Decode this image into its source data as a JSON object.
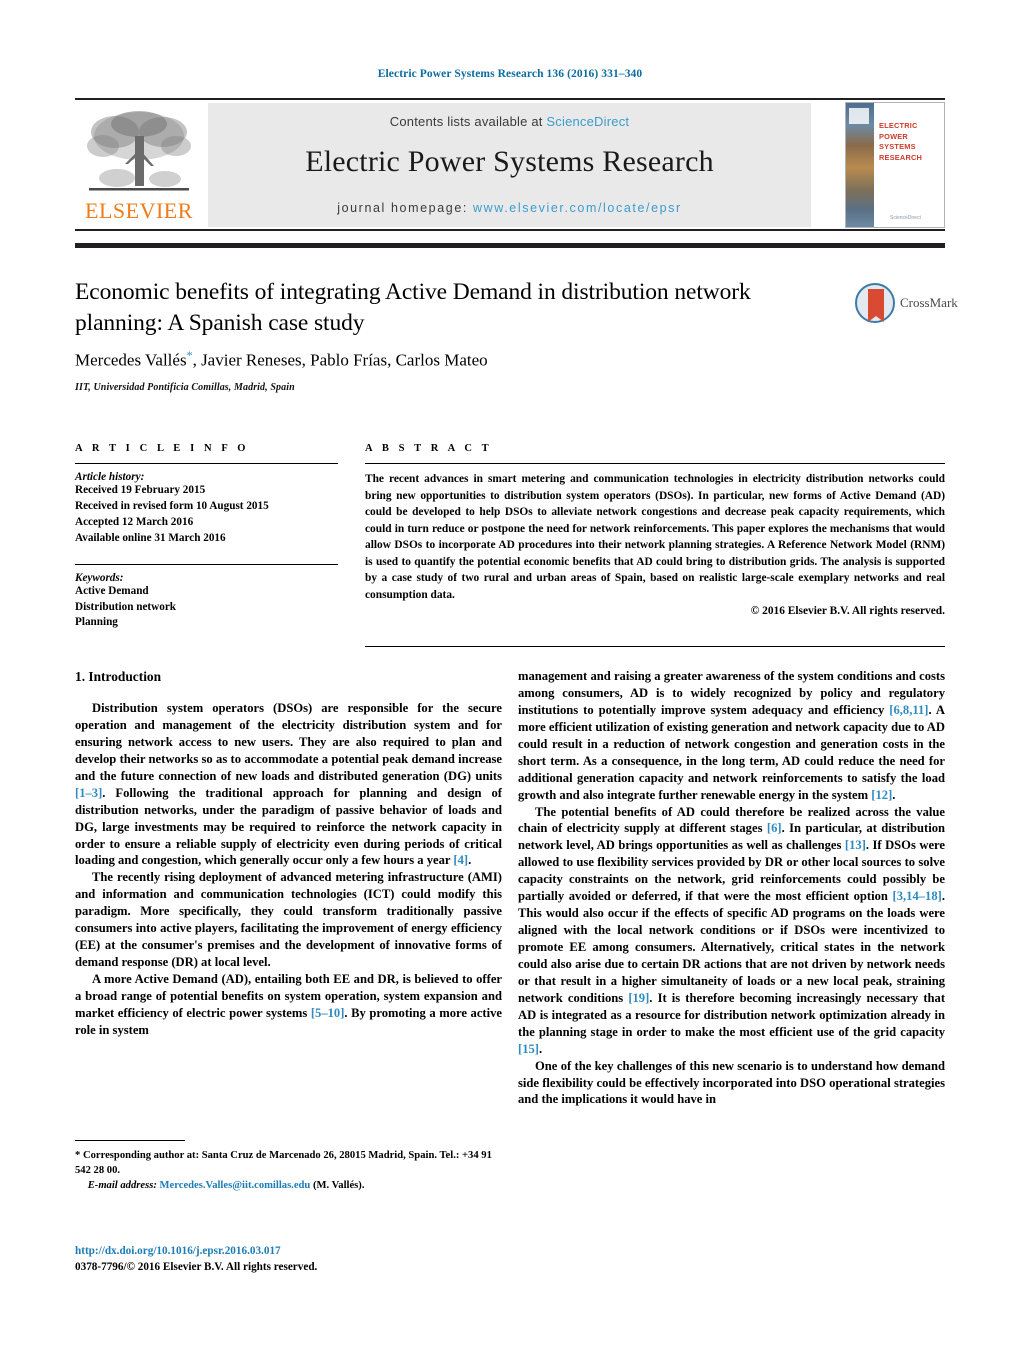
{
  "running_head": "Electric Power Systems Research 136 (2016) 331–340",
  "masthead": {
    "publisher_name": "ELSEVIER",
    "contents_prefix": "Contents lists available at ",
    "sciencedirect": "ScienceDirect",
    "journal_title": "Electric Power Systems Research",
    "homepage_prefix": "journal homepage: ",
    "homepage_url": "www.elsevier.com/locate/epsr",
    "cover": {
      "title_line1": "ELECTRIC POWER",
      "title_line2": "SYSTEMS RESEARCH",
      "footer": "ScienceDirect"
    }
  },
  "article": {
    "title": "Economic benefits of integrating Active Demand in distribution network planning: A Spanish case study",
    "authors_part1": "Mercedes Vallés",
    "authors_star": "*",
    "authors_part2": ", Javier Reneses, Pablo Frías, Carlos Mateo",
    "affiliation": "IIT, Universidad Pontificia Comillas, Madrid, Spain",
    "crossmark_label": "CrossMark"
  },
  "info": {
    "heading": "A R T I C L E   I N F O",
    "history_label": "Article history:",
    "history": [
      "Received 19 February 2015",
      "Received in revised form 10 August 2015",
      "Accepted 12 March 2016",
      "Available online 31 March 2016"
    ],
    "keywords_label": "Keywords:",
    "keywords": [
      "Active Demand",
      "Distribution network",
      "Planning"
    ]
  },
  "abstract": {
    "heading": "A B S T R A C T",
    "text": "The recent advances in smart metering and communication technologies in electricity distribution networks could bring new opportunities to distribution system operators (DSOs). In particular, new forms of Active Demand (AD) could be developed to help DSOs to alleviate network congestions and decrease peak capacity requirements, which could in turn reduce or postpone the need for network reinforcements. This paper explores the mechanisms that would allow DSOs to incorporate AD procedures into their network planning strategies. A Reference Network Model (RNM) is used to quantify the potential economic benefits that AD could bring to distribution grids. The analysis is supported by a case study of two rural and urban areas of Spain, based on realistic large-scale exemplary networks and real consumption data.",
    "copyright": "© 2016 Elsevier B.V. All rights reserved."
  },
  "body": {
    "section_heading": "1.  Introduction",
    "left_paragraphs": [
      {
        "segments": [
          {
            "t": "Distribution system operators (DSOs) are responsible for the secure operation and management of the electricity distribution system and for ensuring network access to new users. They are also required to plan and develop their networks so as to accommodate a potential peak demand increase and the future connection of new loads and distributed generation (DG) units "
          },
          {
            "t": "[1–3]",
            "ref": true
          },
          {
            "t": ". Following the traditional approach for planning and design of distribution networks, under the paradigm of passive behavior of loads and DG, large investments may be required to reinforce the network capacity in order to ensure a reliable supply of electricity even during periods of critical loading and congestion, which generally occur only a few hours a year "
          },
          {
            "t": "[4]",
            "ref": true
          },
          {
            "t": "."
          }
        ]
      },
      {
        "segments": [
          {
            "t": "The recently rising deployment of advanced metering infrastructure (AMI) and information and communication technologies (ICT) could modify this paradigm. More specifically, they could transform traditionally passive consumers into active players, facilitating the improvement of energy efficiency (EE) at the consumer's premises and the development of innovative forms of demand response (DR) at local level."
          }
        ]
      },
      {
        "segments": [
          {
            "t": "A more Active Demand (AD), entailing both EE and DR, is believed to offer a broad range of potential benefits on system operation, system expansion and market efficiency of electric power systems "
          },
          {
            "t": "[5–10]",
            "ref": true
          },
          {
            "t": ". By promoting a more active role in system"
          }
        ]
      }
    ],
    "right_paragraphs": [
      {
        "no_indent": true,
        "segments": [
          {
            "t": "management and raising a greater awareness of the system conditions and costs among consumers, AD is to widely recognized by policy and regulatory institutions to potentially improve system adequacy and efficiency "
          },
          {
            "t": "[6,8,11]",
            "ref": true
          },
          {
            "t": ". A more efficient utilization of existing generation and network capacity due to AD could result in a reduction of network congestion and generation costs in the short term. As a consequence, in the long term, AD could reduce the need for additional generation capacity and network reinforcements to satisfy the load growth and also integrate further renewable energy in the system "
          },
          {
            "t": "[12]",
            "ref": true
          },
          {
            "t": "."
          }
        ]
      },
      {
        "segments": [
          {
            "t": "The potential benefits of AD could therefore be realized across the value chain of electricity supply at different stages "
          },
          {
            "t": "[6]",
            "ref": true
          },
          {
            "t": ". In particular, at distribution network level, AD brings opportunities as well as challenges "
          },
          {
            "t": "[13]",
            "ref": true
          },
          {
            "t": ". If DSOs were allowed to use flexibility services provided by DR or other local sources to solve capacity constraints on the network, grid reinforcements could possibly be partially avoided or deferred, if that were the most efficient option "
          },
          {
            "t": "[3,14–18]",
            "ref": true
          },
          {
            "t": ". This would also occur if the effects of specific AD programs on the loads were aligned with the local network conditions or if DSOs were incentivized to promote EE among consumers. Alternatively, critical states in the network could also arise due to certain DR actions that are not driven by network needs or that result in a higher simultaneity of loads or a new local peak, straining network conditions "
          },
          {
            "t": "[19]",
            "ref": true
          },
          {
            "t": ". It is therefore becoming increasingly necessary that AD is integrated as a resource for distribution network optimization already in the planning stage in order to make the most efficient use of the grid capacity "
          },
          {
            "t": "[15]",
            "ref": true
          },
          {
            "t": "."
          }
        ]
      },
      {
        "segments": [
          {
            "t": "One of the key challenges of this new scenario is to understand how demand side flexibility could be effectively incorporated into DSO operational strategies and the implications it would have in"
          }
        ]
      }
    ]
  },
  "footnote": {
    "star": "*",
    "corresponding": " Corresponding author at: Santa Cruz de Marcenado 26, 28015 Madrid, Spain.",
    "tel": "Tel.: +34 91 542 28 00.",
    "email_label": "E-mail address:",
    "email": "Mercedes.Valles@iit.comillas.edu",
    "email_suffix": " (M. Vallés)."
  },
  "doi": {
    "url": "http://dx.doi.org/10.1016/j.epsr.2016.03.017",
    "issn_line": "0378-7796/© 2016 Elsevier B.V. All rights reserved."
  },
  "colors": {
    "link_blue": "#1c7cb5",
    "ref_blue": "#2e8bc0",
    "elsevier_orange": "#ef7c1a",
    "masthead_bg": "#e9e9e9"
  }
}
